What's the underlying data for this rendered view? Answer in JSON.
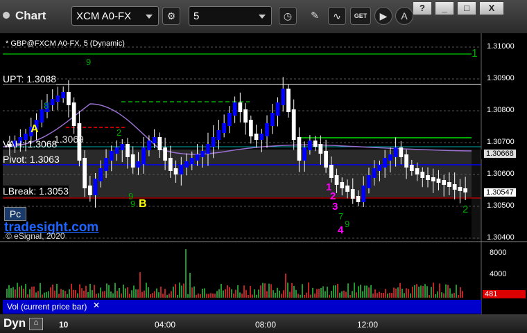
{
  "window": {
    "title": "Chart",
    "symbol": "XCM A0-FX",
    "interval": "5",
    "controls": [
      "?",
      "_",
      "□",
      "X"
    ]
  },
  "chart": {
    "symbol_label": "* GBP@FXCM A0-FX, 5 (Dynamic)",
    "levels": [
      {
        "label": "UPT: 1.3088"
      },
      {
        "label": "VAH: 1.3068"
      },
      {
        "label": "Pivot: 1.3063"
      },
      {
        "label": "LBreak: 1.3053"
      }
    ],
    "price_labels": [
      "1.31000",
      "1.30900",
      "1.30800",
      "1.30700",
      "1.30600",
      "1.30500",
      "1.30400"
    ],
    "current_price_tags": [
      "1.30668",
      "1.30547"
    ],
    "annotations": {
      "a": "A",
      "b": "B",
      "counts": [
        "9",
        "8",
        "9",
        "2",
        "7",
        "9",
        "9",
        "3",
        "1",
        "1",
        "2",
        "3",
        "4",
        "2",
        "1",
        "7",
        "1"
      ],
      "level_value": "1.3069"
    },
    "watermark": "tradesight.com",
    "copyright": "© eSignal, 2020",
    "pc_button": "Pc"
  },
  "volume": {
    "label": "Vol (current price bar)",
    "axis": [
      "8000",
      "4000"
    ],
    "value_tag": "481"
  },
  "time_axis": {
    "labels": [
      "10",
      "04:00",
      "08:00",
      "12:00"
    ],
    "dyn_label": "Dyn"
  },
  "colors": {
    "up": "#0000ff",
    "down": "#ffffff",
    "resistance": "#00aa00",
    "support": "#ff0000",
    "vwap": "#9a6fd0",
    "current": "#ff0000"
  }
}
